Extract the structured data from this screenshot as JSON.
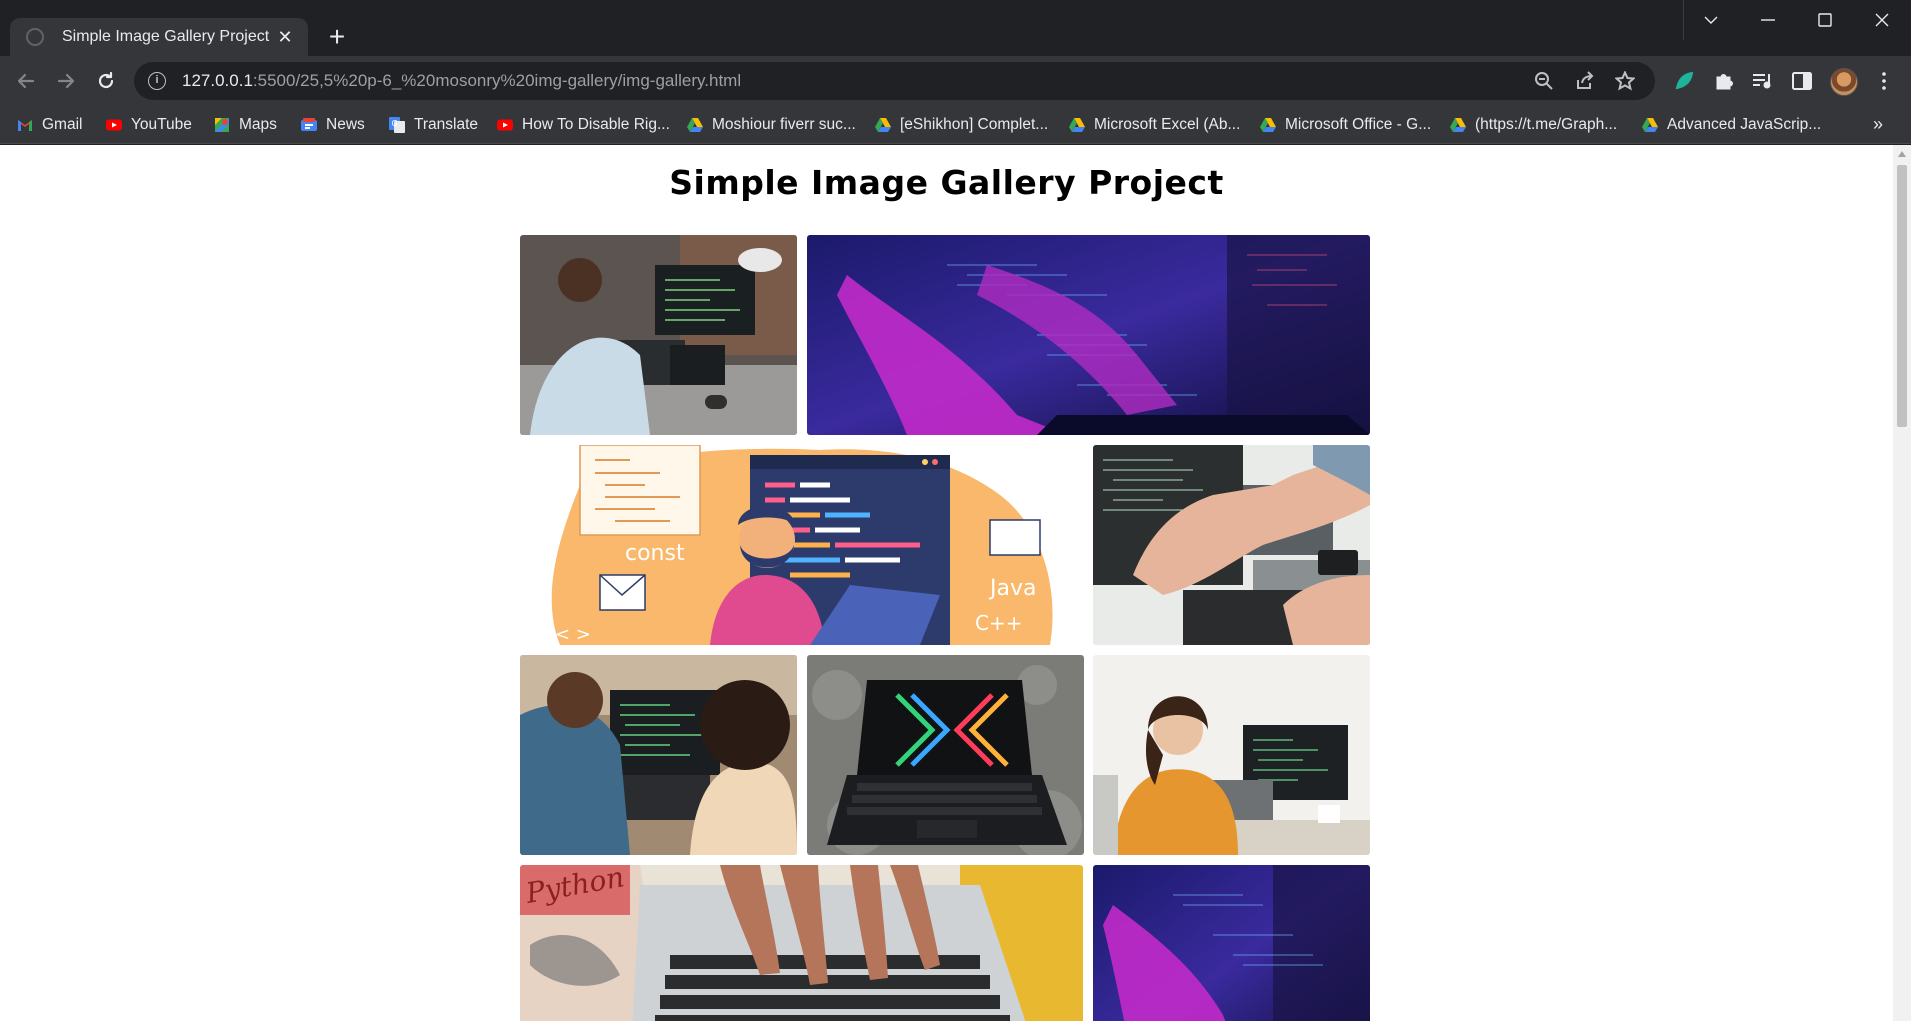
{
  "browser": {
    "tab": {
      "title": "Simple Image Gallery Project"
    },
    "url": {
      "host": "127.0.0.1",
      "path": ":5500/25,5%20p-6_%20mosonry%20img-gallery/img-gallery.html"
    },
    "bookmarks": [
      {
        "label": "Gmail",
        "icon": "gmail-icon"
      },
      {
        "label": "YouTube",
        "icon": "youtube-icon"
      },
      {
        "label": "Maps",
        "icon": "maps-icon"
      },
      {
        "label": "News",
        "icon": "news-icon"
      },
      {
        "label": "Translate",
        "icon": "translate-icon"
      },
      {
        "label": "How To Disable Rig...",
        "icon": "youtube-icon"
      },
      {
        "label": "Moshiour fiverr suc...",
        "icon": "drive-icon"
      },
      {
        "label": "[eShikhon] Complet...",
        "icon": "drive-icon"
      },
      {
        "label": "Microsoft Excel (Ab...",
        "icon": "drive-icon"
      },
      {
        "label": "Microsoft Office - G...",
        "icon": "drive-icon"
      },
      {
        "label": "(https://t.me/Graph...",
        "icon": "drive-icon"
      },
      {
        "label": "Advanced JavaScrip...",
        "icon": "drive-icon"
      }
    ],
    "bookmarks_more": "»"
  },
  "page": {
    "title": "Simple Image Gallery Project",
    "illustration_text": {
      "const": "const",
      "java": "Java",
      "cpp": "C++",
      "brackets": "< >"
    },
    "book_text": "Python",
    "gallery": [
      {
        "name": "gallery-image-developer-laptops"
      },
      {
        "name": "gallery-image-hands-typing-neon"
      },
      {
        "name": "gallery-image-programmer-illustration"
      },
      {
        "name": "gallery-image-pointing-at-screen"
      },
      {
        "name": "gallery-image-pair-programming"
      },
      {
        "name": "gallery-image-rgb-laptop"
      },
      {
        "name": "gallery-image-woman-at-desk"
      },
      {
        "name": "gallery-image-typing-laptop-python-book"
      },
      {
        "name": "gallery-image-hands-typing-neon-2"
      }
    ]
  },
  "colors": {
    "chrome_dark": "#202124",
    "chrome_toolbar": "#35363a",
    "chrome_text": "#e8eaed",
    "page_bg": "#ffffff"
  }
}
